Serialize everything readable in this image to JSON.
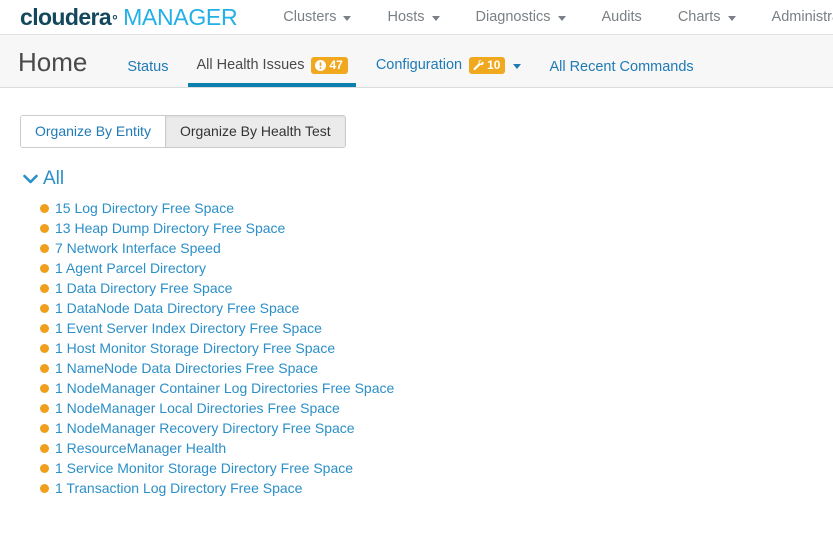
{
  "brand": {
    "name_bold": "cloudera",
    "trademark": "°",
    "name_light": "MANAGER",
    "color_dark": "#13485c",
    "color_light": "#23b0e6"
  },
  "topnav": {
    "items": [
      {
        "label": "Clusters",
        "has_caret": true
      },
      {
        "label": "Hosts",
        "has_caret": true
      },
      {
        "label": "Diagnostics",
        "has_caret": true
      },
      {
        "label": "Audits",
        "has_caret": false
      },
      {
        "label": "Charts",
        "has_caret": true
      },
      {
        "label": "Administration",
        "has_caret": true
      }
    ]
  },
  "subheader": {
    "title": "Home",
    "tabs": [
      {
        "label": "Status",
        "active": false,
        "badge": null,
        "caret": false
      },
      {
        "label": "All Health Issues",
        "active": true,
        "badge": {
          "icon": "alert-icon",
          "value": "47",
          "color": "#f0a81e"
        },
        "caret": false
      },
      {
        "label": "Configuration",
        "active": false,
        "badge": {
          "icon": "wrench-icon",
          "value": "10",
          "color": "#f0a81e"
        },
        "caret": true
      },
      {
        "label": "All Recent Commands",
        "active": false,
        "badge": null,
        "caret": false
      }
    ],
    "active_underline_color": "#0b7fad"
  },
  "organize": {
    "by_entity_label": "Organize By Entity",
    "by_health_test_label": "Organize By Health Test",
    "selected": "Organize By Health Test"
  },
  "group": {
    "label": "All",
    "expanded": true
  },
  "issues": {
    "status_color": "#ef9f1b",
    "items": [
      {
        "count": "15",
        "name": "Log Directory Free Space"
      },
      {
        "count": "13",
        "name": "Heap Dump Directory Free Space"
      },
      {
        "count": "7",
        "name": "Network Interface Speed"
      },
      {
        "count": "1",
        "name": "Agent Parcel Directory"
      },
      {
        "count": "1",
        "name": "Data Directory Free Space"
      },
      {
        "count": "1",
        "name": "DataNode Data Directory Free Space"
      },
      {
        "count": "1",
        "name": "Event Server Index Directory Free Space"
      },
      {
        "count": "1",
        "name": "Host Monitor Storage Directory Free Space"
      },
      {
        "count": "1",
        "name": "NameNode Data Directories Free Space"
      },
      {
        "count": "1",
        "name": "NodeManager Container Log Directories Free Space"
      },
      {
        "count": "1",
        "name": "NodeManager Local Directories Free Space"
      },
      {
        "count": "1",
        "name": "NodeManager Recovery Directory Free Space"
      },
      {
        "count": "1",
        "name": "ResourceManager Health"
      },
      {
        "count": "1",
        "name": "Service Monitor Storage Directory Free Space"
      },
      {
        "count": "1",
        "name": "Transaction Log Directory Free Space"
      }
    ]
  }
}
